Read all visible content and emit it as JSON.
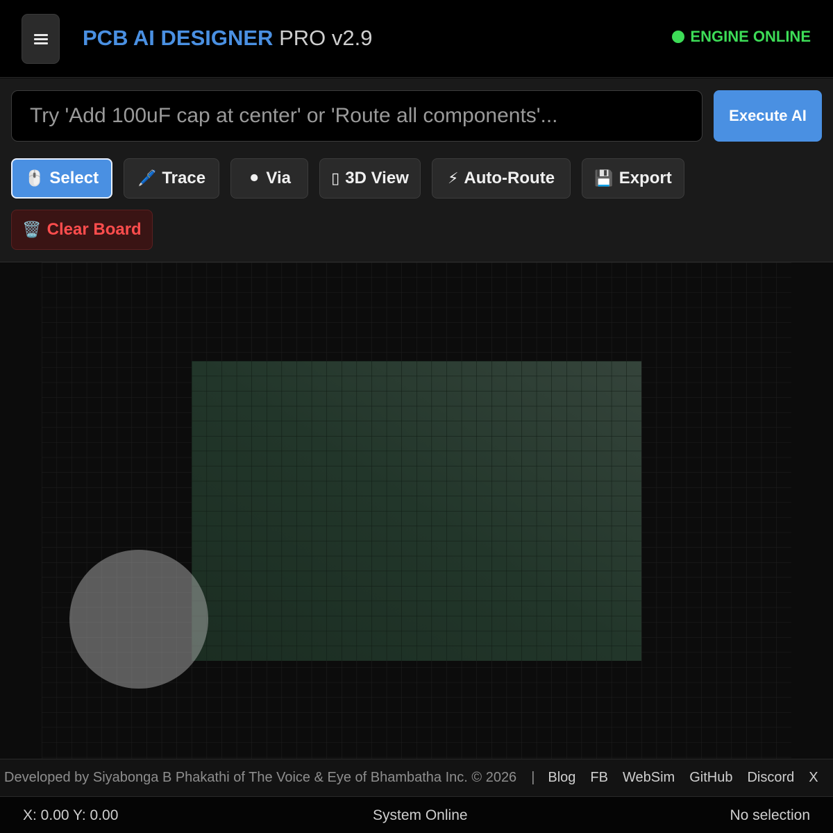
{
  "header": {
    "brand": "PCB AI DESIGNER",
    "version": "PRO v2.9",
    "engine_status": "ENGINE ONLINE",
    "status_color": "#3ddc57",
    "accent_color": "#4a90e2"
  },
  "prompt": {
    "placeholder": "Try 'Add 100uF cap at center' or 'Route all components'...",
    "value": "",
    "execute_label": "Execute AI"
  },
  "tools": [
    {
      "icon": "🖱️",
      "label": "Select",
      "active": true
    },
    {
      "icon": "🖊️",
      "label": "Trace",
      "active": false
    },
    {
      "icon": "⚫",
      "label": "Via",
      "active": false
    },
    {
      "icon": "▯",
      "label": "3D View",
      "active": false
    },
    {
      "icon": "⚡",
      "label": "Auto-Route",
      "active": false
    },
    {
      "icon": "💾",
      "label": "Export",
      "active": false
    },
    {
      "icon": "🗑️",
      "label": "Clear Board",
      "active": false
    }
  ],
  "footer": {
    "credit": "Developed by Siyabonga B Phakathi of The Voice & Eye of Bhambatha Inc. © 2026",
    "separator": "|",
    "links": [
      "Blog",
      "FB",
      "WebSim",
      "GitHub",
      "Discord",
      "X"
    ]
  },
  "statusbar": {
    "coords": "X: 0.00 Y: 0.00",
    "system": "System Online",
    "selection": "No selection"
  }
}
